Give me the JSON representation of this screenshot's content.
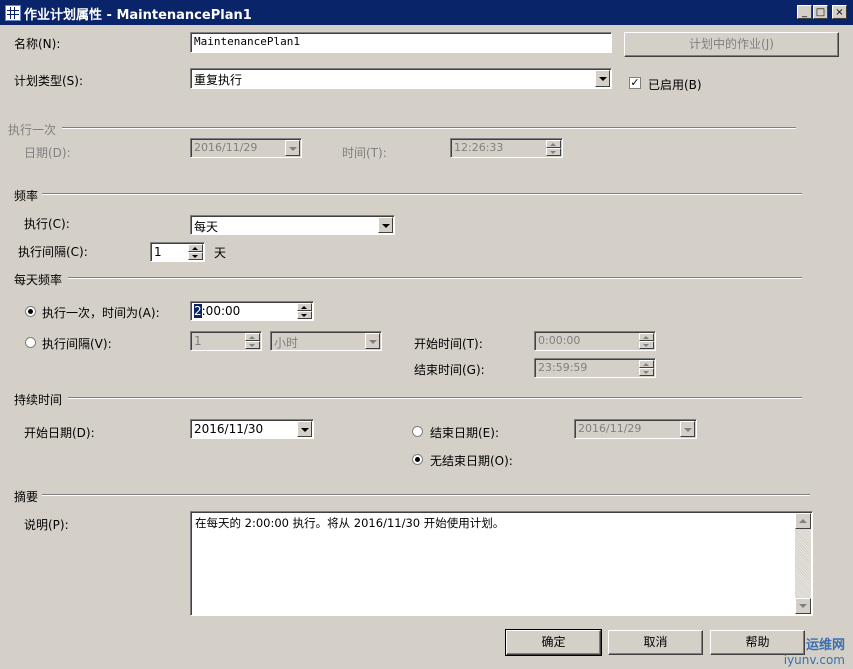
{
  "window": {
    "title": "作业计划属性 - MaintenancePlan1",
    "min": "_",
    "max": "□",
    "close": "×"
  },
  "name": {
    "label": "名称(N):",
    "value": "MaintenancePlan1"
  },
  "jobs_button": "计划中的作业(J)",
  "schedule_type": {
    "label": "计划类型(S):",
    "value": "重复执行"
  },
  "enabled": {
    "label": "已启用(B)",
    "checked": true
  },
  "one_time": {
    "header": "执行一次",
    "date_label": "日期(D):",
    "date_value": "2016/11/29",
    "time_label": "时间(T):",
    "time_value": "12:26:33"
  },
  "frequency": {
    "header": "频率",
    "occurs_label": "执行(C):",
    "occurs_value": "每天",
    "recurs_label": "执行间隔(C):",
    "recurs_value": "1",
    "recurs_unit": "天"
  },
  "daily": {
    "header": "每天频率",
    "once_label": "执行一次，时间为(A):",
    "once_value_sel": "2",
    "once_value_rest": ":00:00",
    "once_selected": true,
    "every_label": "执行间隔(V):",
    "every_value": "1",
    "every_unit": "小时",
    "start_label": "开始时间(T):",
    "start_value": "0:00:00",
    "end_label": "结束时间(G):",
    "end_value": "23:59:59"
  },
  "duration": {
    "header": "持续时间",
    "start_label": "开始日期(D):",
    "start_value": "2016/11/30",
    "end_label": "结束日期(E):",
    "end_value": "2016/11/29",
    "noend_label": "无结束日期(O):",
    "noend_selected": true
  },
  "summary": {
    "header": "摘要",
    "desc_label": "说明(P):",
    "desc_value": "在每天的 2:00:00 执行。将从 2016/11/30 开始使用计划。"
  },
  "buttons": {
    "ok": "确定",
    "cancel": "取消",
    "help": "帮助"
  },
  "watermark": {
    "line1": "运维网",
    "line2": "iyunv.com"
  }
}
